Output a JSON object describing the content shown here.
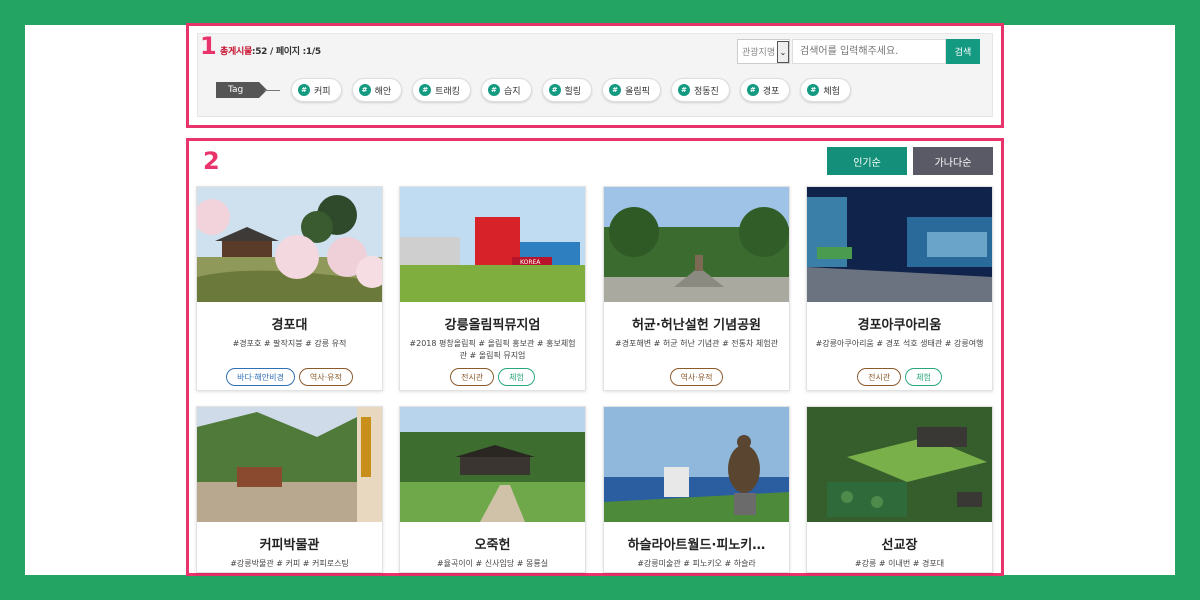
{
  "search_panel": {
    "count_label": "총게시물",
    "count_value": ":52",
    "page_label": "/ 페이지",
    "page_value": ":1/5",
    "select_value": "관광지명",
    "search_placeholder": "검색어를 입력해주세요.",
    "search_button": "검색",
    "tag_label": "Tag",
    "tags": [
      "커피",
      "해안",
      "트래킹",
      "습지",
      "힐링",
      "올림픽",
      "정동진",
      "경포",
      "체험"
    ]
  },
  "annotations": {
    "frame1": "1",
    "frame2": "2"
  },
  "sort": {
    "popular": "인기순",
    "alphabetical": "가나다순"
  },
  "cards": [
    {
      "title": "경포대",
      "tags": "#경포호 # 팔작지붕 # 강릉 유적",
      "cats": [
        {
          "label": "바다·해안비경",
          "color": "blue"
        },
        {
          "label": "역사·유적",
          "color": "brown"
        }
      ]
    },
    {
      "title": "강릉올림픽뮤지엄",
      "tags": "#2018 평창올림픽 # 올림픽 홍보관 # 홍보체험관 # 올림픽 뮤지엄",
      "cats": [
        {
          "label": "전시관",
          "color": "brown"
        },
        {
          "label": "체험",
          "color": "green"
        }
      ]
    },
    {
      "title": "허균·허난설헌 기념공원",
      "tags": "#경포해변 # 허균 허난 기념관 # 전통차 체험관",
      "cats": [
        {
          "label": "역사·유적",
          "color": "brown"
        }
      ]
    },
    {
      "title": "경포아쿠아리움",
      "tags": "#강릉아쿠아리움 # 경포 석호 생태관 # 강릉여행",
      "cats": [
        {
          "label": "전시관",
          "color": "brown"
        },
        {
          "label": "체험",
          "color": "green"
        }
      ]
    },
    {
      "title": "커피박물관",
      "tags": "#강릉박물관 # 커피 # 커피로스팅",
      "cats": []
    },
    {
      "title": "오죽헌",
      "tags": "#율곡이이 # 신사임당 # 몽룡실",
      "cats": []
    },
    {
      "title": "하슬라아트월드·피노키…",
      "tags": "#강릉미술관 # 피노키오 # 하슬라",
      "cats": []
    },
    {
      "title": "선교장",
      "tags": "#강릉 # 이내번 # 경포대",
      "cats": []
    }
  ]
}
